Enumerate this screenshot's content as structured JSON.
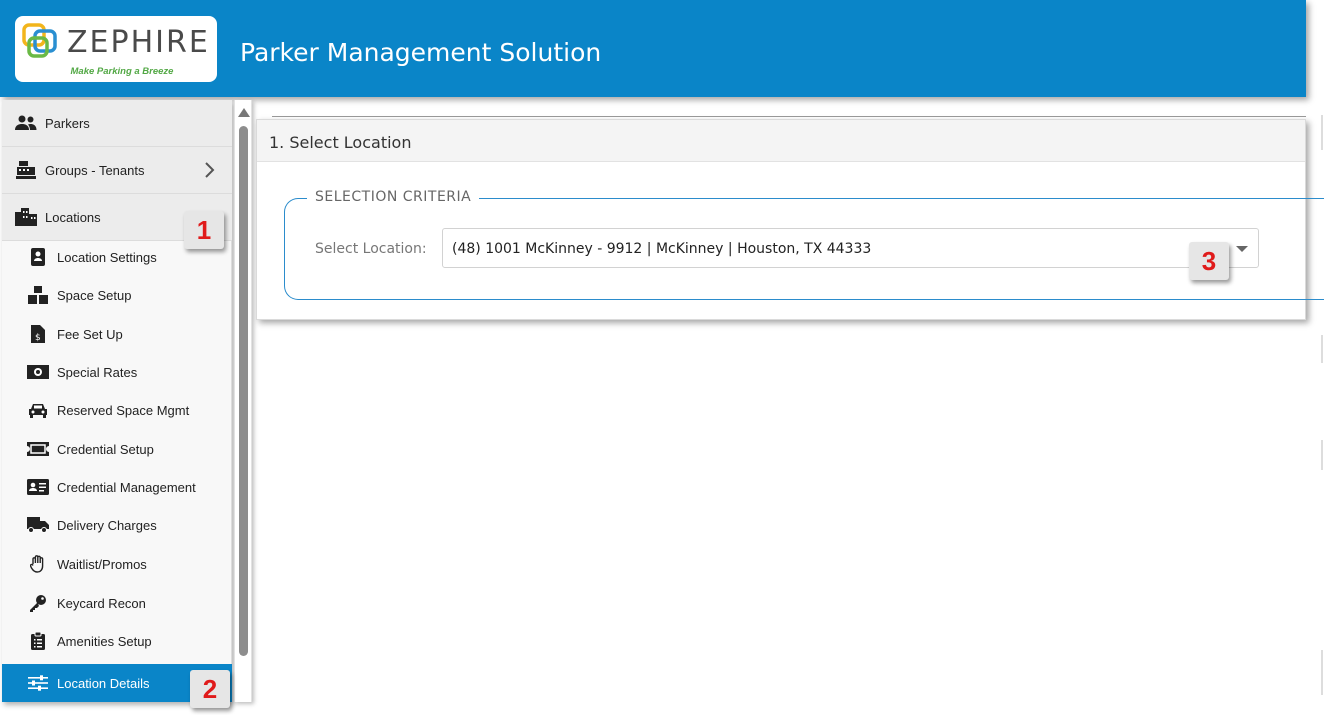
{
  "header": {
    "brand_name": "ZEPHIRE",
    "brand_tagline": "Make Parking a Breeze",
    "app_title": "Parker Management Solution",
    "color": "#0a85c8"
  },
  "sidebar": {
    "top_items": [
      {
        "label": "Parkers",
        "icon": "users-icon"
      },
      {
        "label": "Groups - Tenants",
        "icon": "cash-register-icon"
      },
      {
        "label": "Locations",
        "icon": "city-icon"
      }
    ],
    "sub_items": [
      {
        "label": "Location Settings",
        "icon": "portrait-card-icon"
      },
      {
        "label": "Space Setup",
        "icon": "boxes-icon"
      },
      {
        "label": "Fee Set Up",
        "icon": "invoice-dollar-icon"
      },
      {
        "label": "Special Rates",
        "icon": "money-bill-icon"
      },
      {
        "label": "Reserved Space Mgmt",
        "icon": "car-icon"
      },
      {
        "label": "Credential Setup",
        "icon": "ticket-icon"
      },
      {
        "label": "Credential Management",
        "icon": "id-card-icon"
      },
      {
        "label": "Delivery Charges",
        "icon": "truck-icon"
      },
      {
        "label": "Waitlist/Promos",
        "icon": "hand-icon"
      },
      {
        "label": "Keycard Recon",
        "icon": "key-icon"
      },
      {
        "label": "Amenities Setup",
        "icon": "clipboard-list-icon"
      },
      {
        "label": "Location Details",
        "icon": "sliders-icon",
        "active": true
      }
    ]
  },
  "badges": {
    "one": "1",
    "two": "2",
    "three": "3"
  },
  "main": {
    "panel_title": "1. Select Location",
    "fieldset_legend": "SELECTION CRITERIA",
    "location_label": "Select Location:",
    "location_value": "(48) 1001 McKinney - 9912 | McKinney | Houston, TX 44333"
  }
}
